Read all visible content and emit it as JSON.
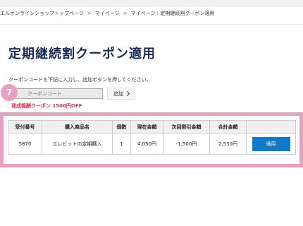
{
  "breadcrumb": [
    "エルオンラインショップトップページ",
    "マイページ",
    "マイページ｜定期継続割クーポン適用"
  ],
  "breadcrumb_separator": ">",
  "page_title": "定期継続割クーポン適用",
  "instruction": "クーポンコードを下記に入力し、追加ボタンを押してください。",
  "coupon_input": {
    "placeholder": "クーポンコード",
    "value": ""
  },
  "add_button_label": "追加",
  "step_badge": "7",
  "coupon_note": "達成報酬クーポン 1500円OFF",
  "table": {
    "headers": [
      "受付番号",
      "購入商品名",
      "個数",
      "現在金額",
      "次回割引金額",
      "合計金額",
      ""
    ],
    "rows": [
      {
        "order_number": "5870",
        "product_name": "エレビットの定期購入",
        "quantity": "1",
        "current_amount": "4,050円",
        "next_discount": "-1,500円",
        "total": "2,550円",
        "apply_label": "適用"
      }
    ]
  },
  "colors": {
    "title": "#1b2b55",
    "accent_pink": "#e8a0bf",
    "discount_red": "#e8294a",
    "apply_blue": "#0f7ac8"
  }
}
